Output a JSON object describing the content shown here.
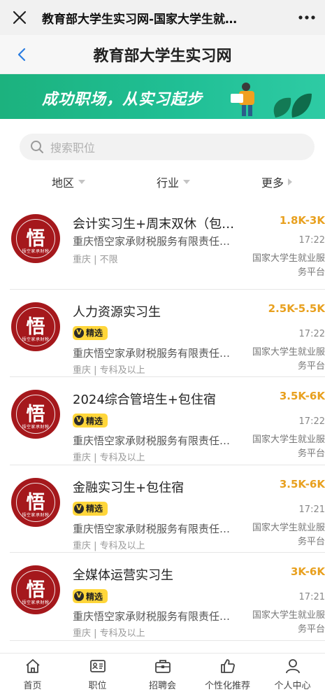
{
  "window": {
    "title": "教育部大学生实习网-国家大学生就…"
  },
  "header": {
    "title": "教育部大学生实习网"
  },
  "banner": {
    "slogan": "成功职场，从实习起步"
  },
  "search": {
    "placeholder": "搜索职位"
  },
  "filters": [
    {
      "label": "地区"
    },
    {
      "label": "行业"
    },
    {
      "label": "更多"
    }
  ],
  "logo": {
    "char": "悟",
    "subtitle": "悟空家承财税"
  },
  "jobs": [
    {
      "title": "会计实习生+周末双休（包…",
      "salary": "1.8K-3K",
      "badge": "",
      "time": "17:22",
      "company": "重庆悟空家承财税服务有限责任…",
      "location": "重庆 | 不限",
      "source": "国家大学生就业服务平台"
    },
    {
      "title": "人力资源实习生",
      "salary": "2.5K-5.5K",
      "badge": "精选",
      "time": "17:22",
      "company": "重庆悟空家承财税服务有限责任…",
      "location": "重庆 | 专科及以上",
      "source": "国家大学生就业服务平台"
    },
    {
      "title": "2024综合管培生+包住宿",
      "salary": "3.5K-6K",
      "badge": "精选",
      "time": "17:22",
      "company": "重庆悟空家承财税服务有限责任…",
      "location": "重庆 | 专科及以上",
      "source": "国家大学生就业服务平台"
    },
    {
      "title": "金融实习生+包住宿",
      "salary": "3.5K-6K",
      "badge": "精选",
      "time": "17:21",
      "company": "重庆悟空家承财税服务有限责任…",
      "location": "重庆 | 专科及以上",
      "source": "国家大学生就业服务平台"
    },
    {
      "title": "全媒体运营实习生",
      "salary": "3K-6K",
      "badge": "精选",
      "time": "17:21",
      "company": "重庆悟空家承财税服务有限责任…",
      "location": "重庆 | 专科及以上",
      "source": "国家大学生就业服务平台"
    }
  ],
  "bottom_nav": [
    {
      "label": "首页",
      "icon": "home-icon"
    },
    {
      "label": "职位",
      "icon": "id-card-icon"
    },
    {
      "label": "招聘会",
      "icon": "briefcase-icon"
    },
    {
      "label": "个性化推荐",
      "icon": "thumbs-up-icon"
    },
    {
      "label": "个人中心",
      "icon": "user-icon"
    }
  ],
  "colors": {
    "banner": "#1cb27e",
    "salary": "#e8a01e",
    "badge": "#ffd63a",
    "logo": "#a5181c"
  }
}
